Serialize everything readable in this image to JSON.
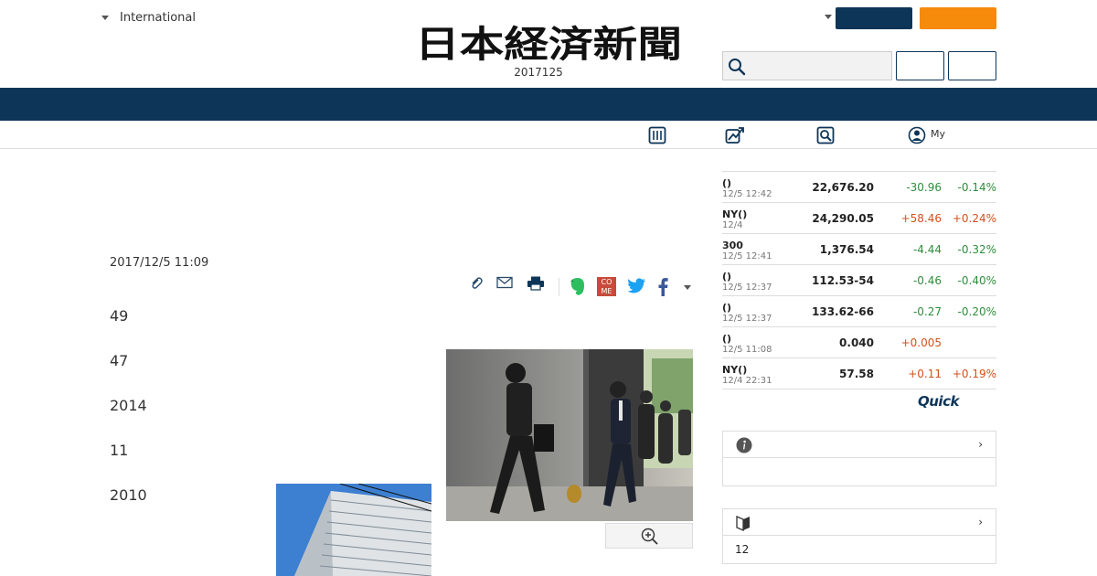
{
  "header": {
    "edition_label": "International",
    "logo_text": "日本経済新聞",
    "date": "2017125",
    "search": {
      "placeholder": ""
    },
    "colors": {
      "navy": "#0d3558",
      "orange": "#f58a0b"
    }
  },
  "subnav": {
    "items": [
      {
        "icon": "newspaper-grid-icon"
      },
      {
        "icon": "market-chart-icon"
      },
      {
        "icon": "search-magnifier-icon"
      },
      {
        "icon": "user-icon",
        "label": "My"
      }
    ]
  },
  "article": {
    "published": "2017/12/5 11:09",
    "paragraphs": [
      "49",
      "47",
      "2014",
      "11",
      "2010"
    ],
    "share_icons": [
      "clip-icon",
      "mail-icon",
      "print-icon",
      "evernote-icon",
      "come-icon",
      "twitter-icon",
      "facebook-icon",
      "more-dropdown-icon"
    ],
    "come_label": "CO ME"
  },
  "market": {
    "rows": [
      {
        "name": "()",
        "time": "12/5 12:42",
        "price": "22,676.20",
        "change": "-30.96",
        "pct": "-0.14%",
        "dir": "down"
      },
      {
        "name": "NY()",
        "time": "12/4",
        "price": "24,290.05",
        "change": "+58.46",
        "pct": "+0.24%",
        "dir": "up"
      },
      {
        "name": "300",
        "time": "12/5 12:41",
        "price": "1,376.54",
        "change": "-4.44",
        "pct": "-0.32%",
        "dir": "down"
      },
      {
        "name": "()",
        "time": "12/5 12:37",
        "price": "112.53-54",
        "change": "-0.46",
        "pct": "-0.40%",
        "dir": "down"
      },
      {
        "name": "()",
        "time": "12/5 12:37",
        "price": "133.62-66",
        "change": "-0.27",
        "pct": "-0.20%",
        "dir": "down"
      },
      {
        "name": "()",
        "time": "12/5 11:08",
        "price": "0.040",
        "change": "+0.005",
        "pct": "",
        "dir": "up"
      },
      {
        "name": "NY()",
        "time": "12/4 22:31",
        "price": "57.58",
        "change": "+0.11",
        "pct": "+0.19%",
        "dir": "up"
      }
    ],
    "provider": "Quick"
  },
  "panels": [
    {
      "icon": "info-icon",
      "chevron": "›",
      "body": ""
    },
    {
      "icon": "beginner-mark-icon",
      "chevron": "›",
      "body": "12"
    }
  ]
}
